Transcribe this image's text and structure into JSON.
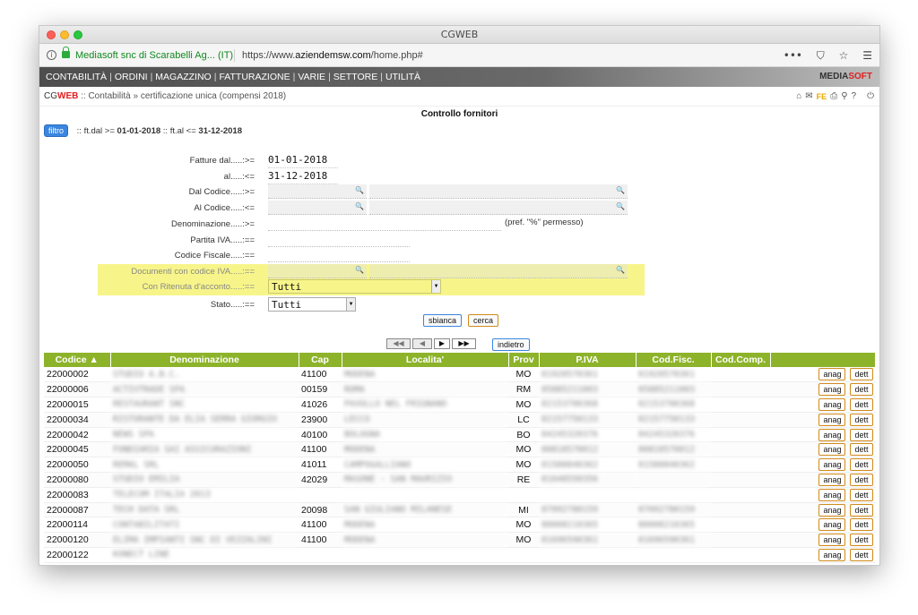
{
  "window": {
    "title": "CGWEB"
  },
  "urlbar": {
    "site": "Mediasoft snc di Scarabelli Ag... (IT)",
    "url_prefix": "https://www.",
    "url_domain": "aziendemsw.com",
    "url_path": "/home.php#",
    "icons": [
      "more-icon",
      "pocket-icon",
      "star-icon",
      "hamburger-menu-icon"
    ]
  },
  "menu": {
    "items": [
      "CONTABILITÀ",
      "ORDINI",
      "MAGAZZINO",
      "FATTURAZIONE",
      "VARIE",
      "SETTORE",
      "UTILITÀ"
    ],
    "brand_a": "MEDIA",
    "brand_b": "SOFT"
  },
  "breadcrumb": {
    "cg": "CG",
    "web": "WEB",
    "path": " :: Contabilità » certificazione unica (compensi 2018)",
    "fe": "FE"
  },
  "page": {
    "title": "Controllo fornitori"
  },
  "filter": {
    "button": "filtro",
    "pre1": ":: ft.dal >= ",
    "dal": "01-01-2018",
    "pre2": " :: ft.al <= ",
    "al": "31-12-2018"
  },
  "form": {
    "fatture_dal_label": "Fatture dal.....:>=",
    "fatture_dal_value": "01-01-2018",
    "al_label": "al.....:<=",
    "al_value": "31-12-2018",
    "dal_codice_label": "Dal Codice.....:>=",
    "al_codice_label": "Al Codice.....:<=",
    "denominazione_label": "Denominazione.....:>=",
    "denominazione_hint": "(pref. \"%\" permesso)",
    "partita_iva_label": "Partita IVA.....:==",
    "codice_fiscale_label": "Codice Fiscale.....:==",
    "documenti_label": "Documenti con codice IVA.....:==",
    "ritenuta_label": "Con Ritenuta d'acconto.....:==",
    "ritenuta_value": "Tutti",
    "stato_label": "Stato.....:==",
    "stato_value": "Tutti",
    "sbianca": "sbianca",
    "cerca": "cerca"
  },
  "pager": {
    "first": "◀◀",
    "prev": "◀",
    "next": "▶",
    "last": "▶▶",
    "back": "indietro"
  },
  "table": {
    "headers": [
      "Codice ▲",
      "Denominazione",
      "Cap",
      "Localita'",
      "Prov",
      "P.IVA",
      "Cod.Fisc.",
      "Cod.Comp.",
      ""
    ],
    "btn_anag": "anag",
    "btn_dett": "dett",
    "rows": [
      {
        "codice": "22000002",
        "den": "STUDIO A.B.C.",
        "cap": "41100",
        "loc": "MODENA",
        "prov": "MO",
        "piva": "01920570361",
        "cf": "01920570361"
      },
      {
        "codice": "22000006",
        "den": "ACTIVTRADE SPA",
        "cap": "00159",
        "loc": "ROMA",
        "prov": "RM",
        "piva": "05885211003",
        "cf": "05885211003"
      },
      {
        "codice": "22000015",
        "den": "RESTAURANT SNC",
        "cap": "41026",
        "loc": "PAVULLO NEL FRIGNANO",
        "prov": "MO",
        "piva": "02153700368",
        "cf": "02153700368"
      },
      {
        "codice": "22000034",
        "den": "RISTORANTE DA ELIA SERRA GIORGIO",
        "cap": "23900",
        "loc": "LECCO",
        "prov": "LC",
        "piva": "02157750133",
        "cf": "02157750133"
      },
      {
        "codice": "22000042",
        "den": "NEWS SPA",
        "cap": "40100",
        "loc": "BOLOGNA",
        "prov": "BO",
        "piva": "04245320376",
        "cf": "04245320376"
      },
      {
        "codice": "22000045",
        "den": "FONDIARIA SAI ASSICURAZIONI",
        "cap": "41100",
        "loc": "MODENA",
        "prov": "MO",
        "piva": "00818570012",
        "cf": "00818570012"
      },
      {
        "codice": "22000050",
        "den": "REMAL SRL",
        "cap": "41011",
        "loc": "CAMPOGALLIANO",
        "prov": "MO",
        "piva": "01588840362",
        "cf": "01588840362"
      },
      {
        "codice": "22000080",
        "den": "STUDIO EMILIA",
        "cap": "42029",
        "loc": "MASONE - SAN MAURIZIO",
        "prov": "RE",
        "piva": "01648550356",
        "cf": ""
      },
      {
        "codice": "22000083",
        "den": "TELECOM ITALIA 2013",
        "cap": "",
        "loc": "",
        "prov": "",
        "piva": "",
        "cf": ""
      },
      {
        "codice": "22000087",
        "den": "TECH DATA SRL",
        "cap": "20098",
        "loc": "SAN GIULIANO MILANESE",
        "prov": "MI",
        "piva": "07092780159",
        "cf": "07092780159"
      },
      {
        "codice": "22000114",
        "den": "CONTABILITATI",
        "cap": "41100",
        "loc": "MODENA",
        "prov": "MO",
        "piva": "80008210365",
        "cf": "80008210365"
      },
      {
        "codice": "22000120",
        "den": "ELIMA IMPIANTI SNC DI VEZZALINI",
        "cap": "41100",
        "loc": "MODENA",
        "prov": "MO",
        "piva": "01696590361",
        "cf": "01696590361"
      },
      {
        "codice": "22000122",
        "den": "KONECT LINE",
        "cap": "",
        "loc": "",
        "prov": "",
        "piva": "",
        "cf": ""
      }
    ]
  }
}
